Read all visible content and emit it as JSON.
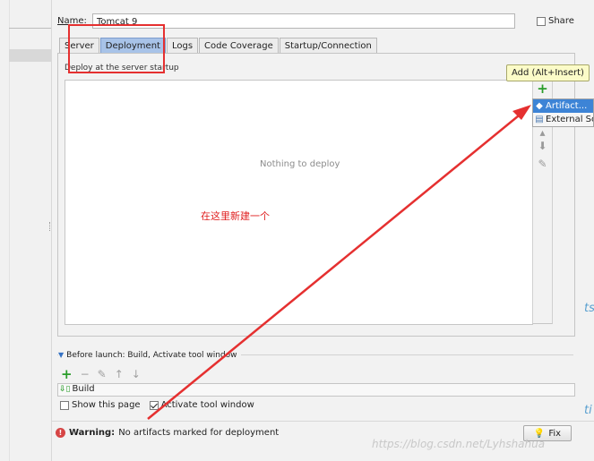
{
  "config": {
    "name_label": "Name:",
    "name_value": "Tomcat 9",
    "share_label": "Share",
    "share_checked": false
  },
  "tabs": [
    {
      "label": "Server",
      "active": false
    },
    {
      "label": "Deployment",
      "active": true
    },
    {
      "label": "Logs",
      "active": false
    },
    {
      "label": "Code Coverage",
      "active": false
    },
    {
      "label": "Startup/Connection",
      "active": false
    }
  ],
  "deployment": {
    "section_label": "Deploy at the server startup",
    "empty_text": "Nothing to deploy",
    "tooltip": "Add (Alt+Insert)",
    "popup_items": [
      {
        "label": "Artifact...",
        "icon": "artifact-icon",
        "selected": true
      },
      {
        "label": "External So",
        "icon": "external-source-icon",
        "selected": false
      }
    ],
    "toolbar_icons": [
      "add-icon",
      "remove-icon",
      "move-up-icon",
      "move-down-icon",
      "edit-icon"
    ]
  },
  "annotation": {
    "text": "在这里新建一个",
    "color": "#e02020"
  },
  "before_launch": {
    "title": "Before launch: Build, Activate tool window",
    "toolbar_icons": [
      "add-icon",
      "remove-icon",
      "edit-icon",
      "move-up-icon",
      "move-down-icon"
    ],
    "items": [
      {
        "label": "Build",
        "icon": "build-icon"
      }
    ]
  },
  "options": {
    "show_page_label": "Show this page",
    "show_page_checked": false,
    "activate_label": "Activate tool window",
    "activate_checked": true
  },
  "warning": {
    "label": "Warning:",
    "message": "No artifacts marked for deployment",
    "fix_label": "Fix"
  },
  "watermark": "https://blog.csdn.net/Lyhshahua",
  "edge_fragments": [
    "ts",
    "ti"
  ],
  "colors": {
    "active_tab": "#a8c3e8",
    "selection": "#3d84d6",
    "add_green": "#2a9d2a",
    "tooltip_bg": "#fbfbc8"
  }
}
